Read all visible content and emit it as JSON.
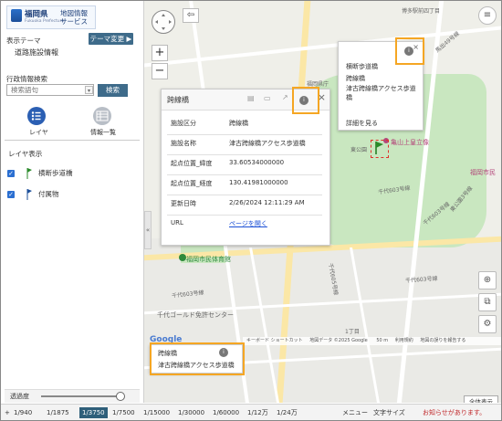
{
  "logo": {
    "name": "福岡県",
    "subname": "Fukuoka Prefecture",
    "service": "地図情報\nサービス"
  },
  "sidebar": {
    "theme_label": "表示テーマ",
    "theme_value": "道路施設情報",
    "theme_change_button": "テーマ変更 ▶",
    "search_title": "行政情報検索",
    "search_placeholder": "検索語句",
    "search_button": "検索",
    "tabs": [
      {
        "label": "レイヤ",
        "icon": "list-icon"
      },
      {
        "label": "情報一覧",
        "icon": "table-icon"
      }
    ],
    "layer_title": "レイヤ表示",
    "layers": [
      {
        "label": "横断歩道橋",
        "checked": true,
        "color": "#2a8a2a"
      },
      {
        "label": "付属物",
        "checked": true,
        "color": "#1c4f9a"
      }
    ],
    "opacity_label": "透過度"
  },
  "map": {
    "labels": {
      "hakata": "博多駅前四丁目",
      "fukuoka_office": "福岡県庁",
      "higashi_koen": "東公園",
      "fukuoka_office2": "福岡県庁",
      "statue": "亀山上皇立像",
      "fukuoka_city": "福岡市民",
      "sports_hall": "福岡市民体育館",
      "chiyo": "千代ゴールド免許センター",
      "road602": "602",
      "road603a": "千代603号線",
      "road603b": "千代603号線",
      "road603c": "千代603号線",
      "road603d": "千代603号線",
      "road605": "千代605号線",
      "higashi": "東公園3号線",
      "baba": "馬出49号線",
      "chome": "1丁目",
      "ikegawa": "東公園線",
      "right_road": "馬出49号線",
      "hosp": "東公園",
      "school": "学校"
    },
    "google": "Google",
    "attribution": [
      "キーボード ショートカット",
      "地図データ ©2025 Google",
      "50 m",
      "利用規約",
      "地図の誤りを報告する"
    ]
  },
  "attr_popup": {
    "title": "跨線橋",
    "rows": [
      {
        "key": "施設区分",
        "value": "跨線橋"
      },
      {
        "key": "施設名称",
        "value": "津古跨線橋アクセス歩道橋"
      },
      {
        "key": "起点位置_緯度",
        "value": "33.60534000000"
      },
      {
        "key": "起点位置_経度",
        "value": "130.41981000000"
      },
      {
        "key": "更新日時",
        "value": "2/26/2024 12:11:29 AM"
      },
      {
        "key": "URL",
        "value": "ページを開く"
      }
    ]
  },
  "list_popup": {
    "items": [
      "横断歩道橋",
      "跨線橋",
      "津古跨線橋アクセス歩道橋"
    ],
    "more": "詳細を見る"
  },
  "tooltip_popup": {
    "title": "跨線橋",
    "value": "津古跨線橋アクセス歩道橋"
  },
  "bottom": {
    "scales": [
      "1/940",
      "1/1875",
      "1/3750",
      "1/7500",
      "1/15000",
      "1/30000",
      "1/60000",
      "1/12万",
      "1/24万"
    ],
    "active_scale": "1/3750",
    "menu": "メニュー",
    "text_size": "文字サイズ",
    "notice": "お知らせがあります。",
    "fullscreen": "全体表示"
  }
}
